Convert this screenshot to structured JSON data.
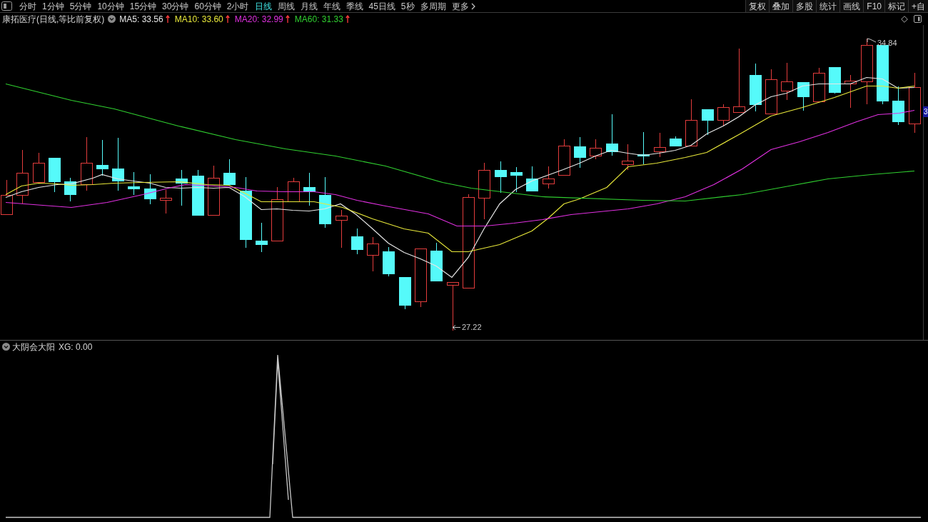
{
  "toolbar": {
    "periods": [
      {
        "label": "分时",
        "selected": false
      },
      {
        "label": "1分钟",
        "selected": false
      },
      {
        "label": "5分钟",
        "selected": false
      },
      {
        "label": "10分钟",
        "selected": false
      },
      {
        "label": "15分钟",
        "selected": false
      },
      {
        "label": "30分钟",
        "selected": false
      },
      {
        "label": "60分钟",
        "selected": false
      },
      {
        "label": "2小时",
        "selected": false
      },
      {
        "label": "日线",
        "selected": true
      },
      {
        "label": "周线",
        "selected": false
      },
      {
        "label": "月线",
        "selected": false
      },
      {
        "label": "年线",
        "selected": false
      },
      {
        "label": "季线",
        "selected": false
      },
      {
        "label": "45日线",
        "selected": false
      },
      {
        "label": "5秒",
        "selected": false
      },
      {
        "label": "多周期",
        "selected": false
      }
    ],
    "more": "更多",
    "buttons": [
      "复权",
      "叠加",
      "多股",
      "统计",
      "画线",
      "F10",
      "标记",
      "+自"
    ]
  },
  "chart_header": {
    "title": "康拓医疗(日线,等比前复权)",
    "indicators": [
      {
        "label": "MA5: 33.56",
        "color": "#e6e6e6",
        "rising": true
      },
      {
        "label": "MA10: 33.60",
        "color": "#e8e83a",
        "rising": true
      },
      {
        "label": "MA20: 32.99",
        "color": "#e030e0",
        "rising": true
      },
      {
        "label": "MA60: 31.33",
        "color": "#30d030",
        "rising": true
      }
    ]
  },
  "main_chart": {
    "high_label": "34.84",
    "low_label": "27.22",
    "price_tag": "3"
  },
  "indicator_panel": {
    "title": "大阴会大阳",
    "reading": "XG: 0.00"
  }
}
